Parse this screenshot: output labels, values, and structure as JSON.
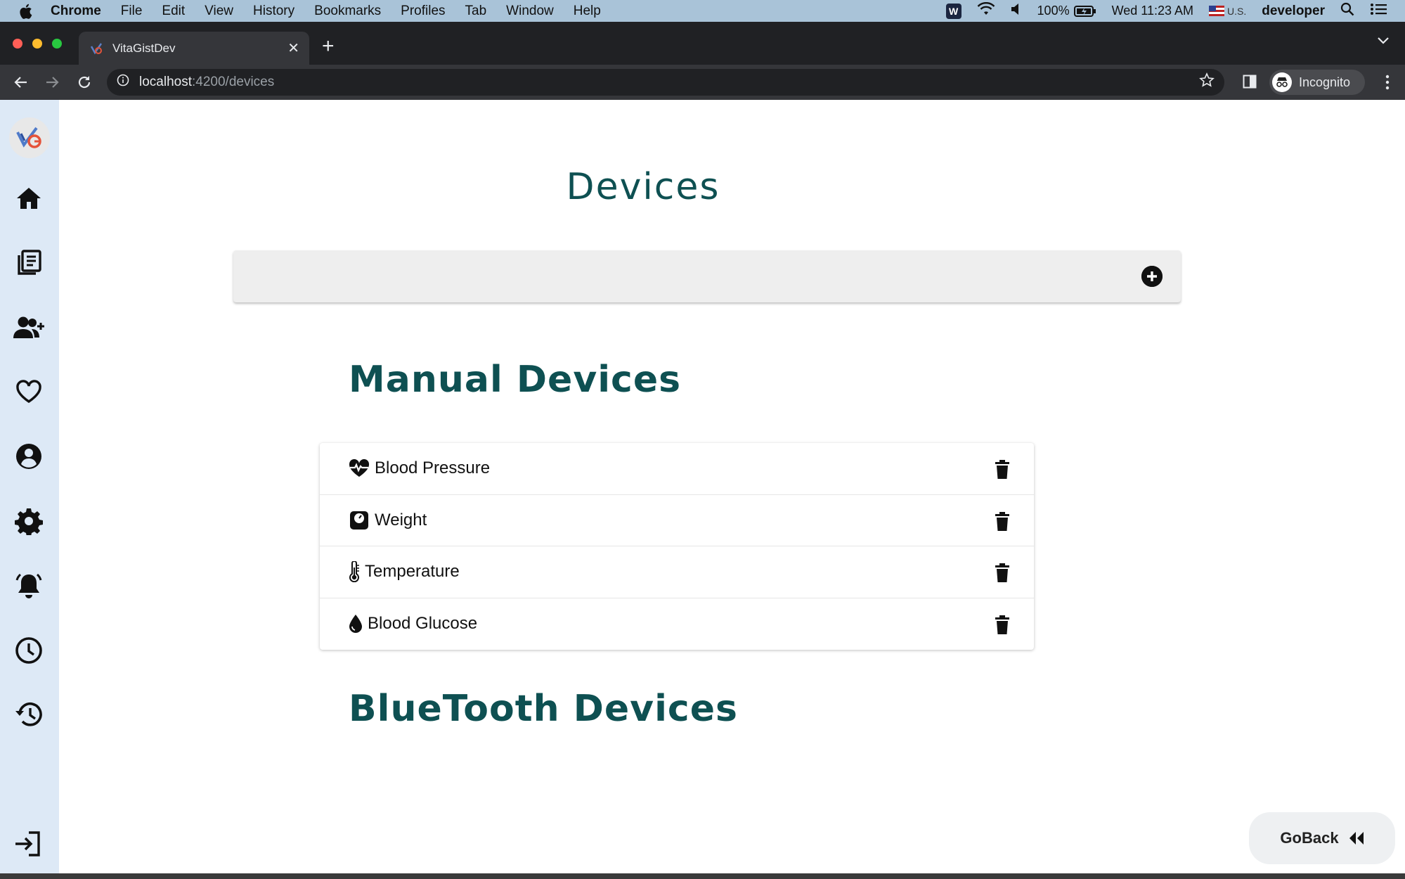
{
  "menubar": {
    "app_name": "Chrome",
    "items": [
      "File",
      "Edit",
      "View",
      "History",
      "Bookmarks",
      "Profiles",
      "Tab",
      "Window",
      "Help"
    ],
    "battery": "100%",
    "datetime": "Wed 11:23 AM",
    "input_source": "U.S.",
    "user": "developer"
  },
  "browser": {
    "tab_title": "VitaGistDev",
    "url_host": "localhost",
    "url_path": ":4200/devices",
    "profile_label": "Incognito"
  },
  "sidebar": {
    "items": [
      {
        "name": "home-icon"
      },
      {
        "name": "journal-icon"
      },
      {
        "name": "add-user-icon"
      },
      {
        "name": "heart-icon"
      },
      {
        "name": "profile-icon"
      },
      {
        "name": "gear-icon"
      },
      {
        "name": "alarm-bell-icon"
      },
      {
        "name": "clock-icon"
      },
      {
        "name": "history-icon"
      },
      {
        "name": "logout-icon"
      }
    ]
  },
  "page": {
    "title": "Devices",
    "manual_section_title": "Manual Devices",
    "bluetooth_section_title": "BlueTooth Devices",
    "manual_devices": [
      {
        "label": "Blood Pressure",
        "icon": "heart-pulse-icon"
      },
      {
        "label": "Weight",
        "icon": "scale-icon"
      },
      {
        "label": "Temperature",
        "icon": "thermometer-icon"
      },
      {
        "label": "Blood Glucose",
        "icon": "droplet-icon"
      }
    ],
    "go_back_label": "GoBack"
  },
  "colors": {
    "heading": "#0e5052",
    "sidebar_bg": "#dde9f6",
    "add_bar_bg": "#eeeeee"
  }
}
